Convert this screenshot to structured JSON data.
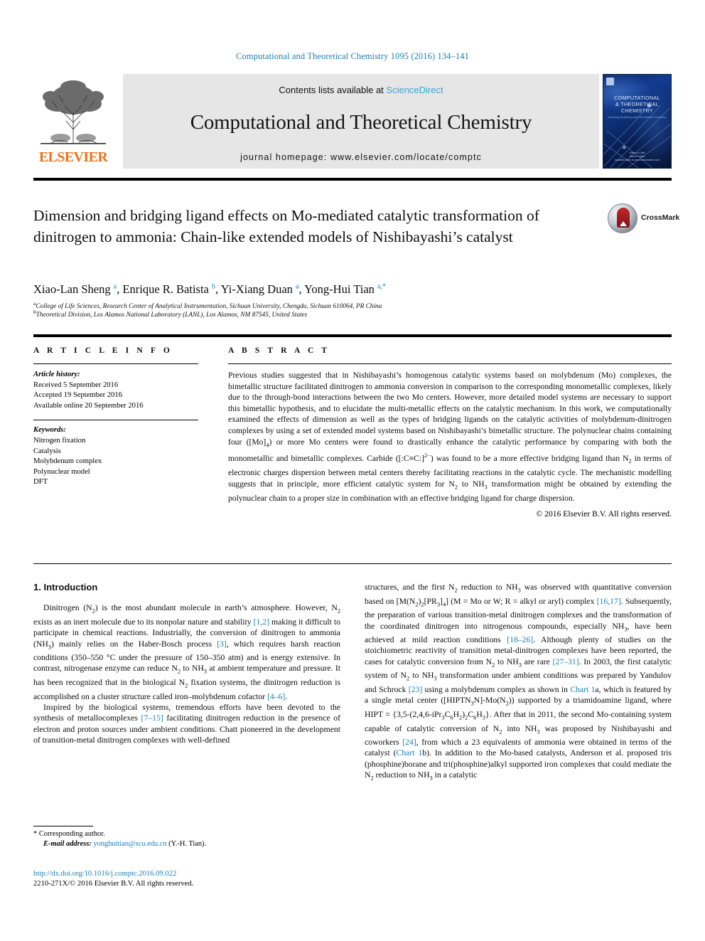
{
  "running_head": "Computational and Theoretical Chemistry 1095 (2016) 134–141",
  "masthead": {
    "publisher": "ELSEVIER",
    "contents_prefix": "Contents lists available at ",
    "contents_link": "ScienceDirect",
    "journal_title": "Computational and Theoretical Chemistry",
    "homepage": "journal homepage: www.elsevier.com/locate/comptc",
    "cover": {
      "title_line1": "COMPUTATIONAL",
      "title_line2": "& THEORETICAL",
      "title_line3": "CHEMISTRY",
      "subtitle": "Including Modelling and Theoretical Chemistry",
      "footer_line1": "Editor-in-Chief",
      "footer_line2": "Manuel Yáñez",
      "footer_line3": "available online at www.sciencedirect.com"
    }
  },
  "article": {
    "title": "Dimension and bridging ligand effects on Mo-mediated catalytic transformation of dinitrogen to ammonia: Chain-like extended models of Nishibayashi’s catalyst",
    "crossmark_label": "CrossMark",
    "authors_html": "Xiao-Lan Sheng <sup>a</sup>, Enrique R. Batista <sup>b</sup>, Yi-Xiang Duan <sup>a</sup>, Yong-Hui Tian <sup>a,*</sup>",
    "affiliation_a": "College of Life Sciences, Research Center of Analytical Instrumentation, Sichuan University, Chengdu, Sichuan 610064, PR China",
    "affiliation_b": "Theoretical Division, Los Alamos National Laboratory (LANL), Los Alamos, NM 87545, United States"
  },
  "article_info": {
    "heading": "A R T I C L E   I N F O",
    "history_label": "Article history:",
    "history": [
      "Received 5 September 2016",
      "Accepted 19 September 2016",
      "Available online 20 September 2016"
    ],
    "keywords_label": "Keywords:",
    "keywords": [
      "Nitrogen fixation",
      "Catalysis",
      "Molybdenum complex",
      "Polynuclear model",
      "DFT"
    ]
  },
  "abstract": {
    "heading": "A B S T R A C T",
    "body_html": "Previous studies suggested that in Nishibayashi’s homogenous catalytic systems based on molybdenum (Mo) complexes, the bimetallic structure facilitated dinitrogen to ammonia conversion in comparison to the corresponding monometallic complexes, likely due to the through-bond interactions between the two Mo centers. However, more detailed model systems are necessary to support this bimetallic hypothesis, and to elucidate the multi-metallic effects on the catalytic mechanism. In this work, we computationally examined the effects of dimension as well as the types of bridging ligands on the catalytic activities of molybdenum-dinitrogen complexes by using a set of extended model systems based on Nishibayashi’s bimetallic structure. The polynuclear chains containing four ([Mo]<sub>4</sub>) or more Mo centers were found to drastically enhance the catalytic performance by comparing with both the monometallic and bimetallic complexes. Carbide ([:C&#8801;C:]<sup class=\"num\">2&#8722;</sup>) was found to be a more effective bridging ligand than N<sub>2</sub> in terms of electronic charges dispersion between metal centers thereby facilitating reactions in the catalytic cycle. The mechanistic modelling suggests that in principle, more efficient catalytic system for N<sub>2</sub> to NH<sub>3</sub> transformation might be obtained by extending the polynuclear chain to a proper size in combination with an effective bridging ligand for charge dispersion.",
    "copyright": "© 2016 Elsevier B.V. All rights reserved."
  },
  "introduction": {
    "section_title": "1. Introduction",
    "left_paragraphs_html": [
      "Dinitrogen (N<sub>2</sub>) is the most abundant molecule in earth’s atmosphere. However, N<sub>2</sub> exists as an inert molecule due to its nonpolar nature and stability <span class=\"ref\">[1,2]</span> making it difficult to participate in chemical reactions. Industrially, the conversion of dinitrogen to ammonia (NH<sub>3</sub>) mainly relies on the Haber-Bosch process <span class=\"ref\">[3]</span>, which requires harsh reaction conditions (350–550 °C under the pressure of 150–350 atm) and is energy extensive. In contrast, nitrogenase enzyme can reduce N<sub>2</sub> to NH<sub>3</sub> at ambient temperature and pressure. It has been recognized that in the biological N<sub>2</sub> fixation systems, the dinitrogen reduction is accomplished on a cluster structure called iron–molybdenum cofactor <span class=\"ref\">[4–6]</span>.",
      "Inspired by the biological systems, tremendous efforts have been devoted to the synthesis of metallocomplexes <span class=\"ref\">[7–15]</span> facilitating dinitrogen reduction in the presence of electron and proton sources under ambient conditions. Chatt pioneered in the development of transition-metal dinitrogen complexes with well-defined"
    ],
    "right_paragraphs_html": [
      "structures, and the first N<sub>2</sub> reduction to NH<sub>3</sub> was observed with quantitative conversion based on [M(N<sub>2</sub>)<sub>2</sub>[PR<sub>3</sub>]<sub>4</sub>] (M = Mo or W; R = alkyl or aryl) complex <span class=\"ref\">[16,17]</span>. Subsequently, the preparation of various transition-metal dinitrogen complexes and the transformation of the coordinated dinitrogen into nitrogenous compounds, especially NH<sub>3</sub>, have been achieved at mild reaction conditions <span class=\"ref\">[18–26]</span>. Although plenty of studies on the stoichiometric reactivity of transition metal-dinitrogen complexes have been reported, the cases for catalytic conversion from N<sub>2</sub> to NH<sub>3</sub> are rare <span class=\"ref\">[27–31]</span>. In 2003, the first catalytic system of N<sub>2</sub> to NH<sub>3</sub> transformation under ambient conditions was prepared by Yandulov and Schrock <span class=\"ref\">[23]</span> using a molybdenum complex as shown in <span class=\"chartref\">Chart 1</span>a, which is featured by a single metal center ([HIPTN<sub>3</sub>N]-Mo(N<sub>2</sub>)) supported by a triamidoamine ligand, where HIPT = {3,5-(2,4,6-iPr<sub>3</sub>C<sub>6</sub>H<sub>2</sub>)<sub>2</sub>C<sub>6</sub>H<sub>3</sub>}. After that in 2011, the second Mo-containing system capable of catalytic conversion of N<sub>2</sub> into NH<sub>3</sub> was proposed by Nishibayashi and coworkers <span class=\"ref\">[24]</span>, from which a 23 equivalents of ammonia were obtained in terms of the catalyst (<span class=\"chartref\">Chart 1</span>b). In addition to the Mo-based catalysts, Anderson et al. proposed tris (phosphine)borane and tri(phosphine)alkyl supported iron complexes that could mediate the N<sub>2</sub> reduction to NH<sub>3</sub> in a catalytic"
    ]
  },
  "footer": {
    "corresponding_marker": "*",
    "corresponding_label": "Corresponding author.",
    "email_label": "E-mail address:",
    "email": "yonghuitian@scu.edu.cn",
    "email_suffix": "(Y.-H. Tian).",
    "doi": "http://dx.doi.org/10.1016/j.comptc.2016.09.022",
    "imprint": "2210-271X/© 2016 Elsevier B.V. All rights reserved."
  },
  "colors": {
    "link": "#1a7fb5",
    "elsevier_orange": "#e8731a",
    "masthead_bg": "#e6e6e6"
  }
}
